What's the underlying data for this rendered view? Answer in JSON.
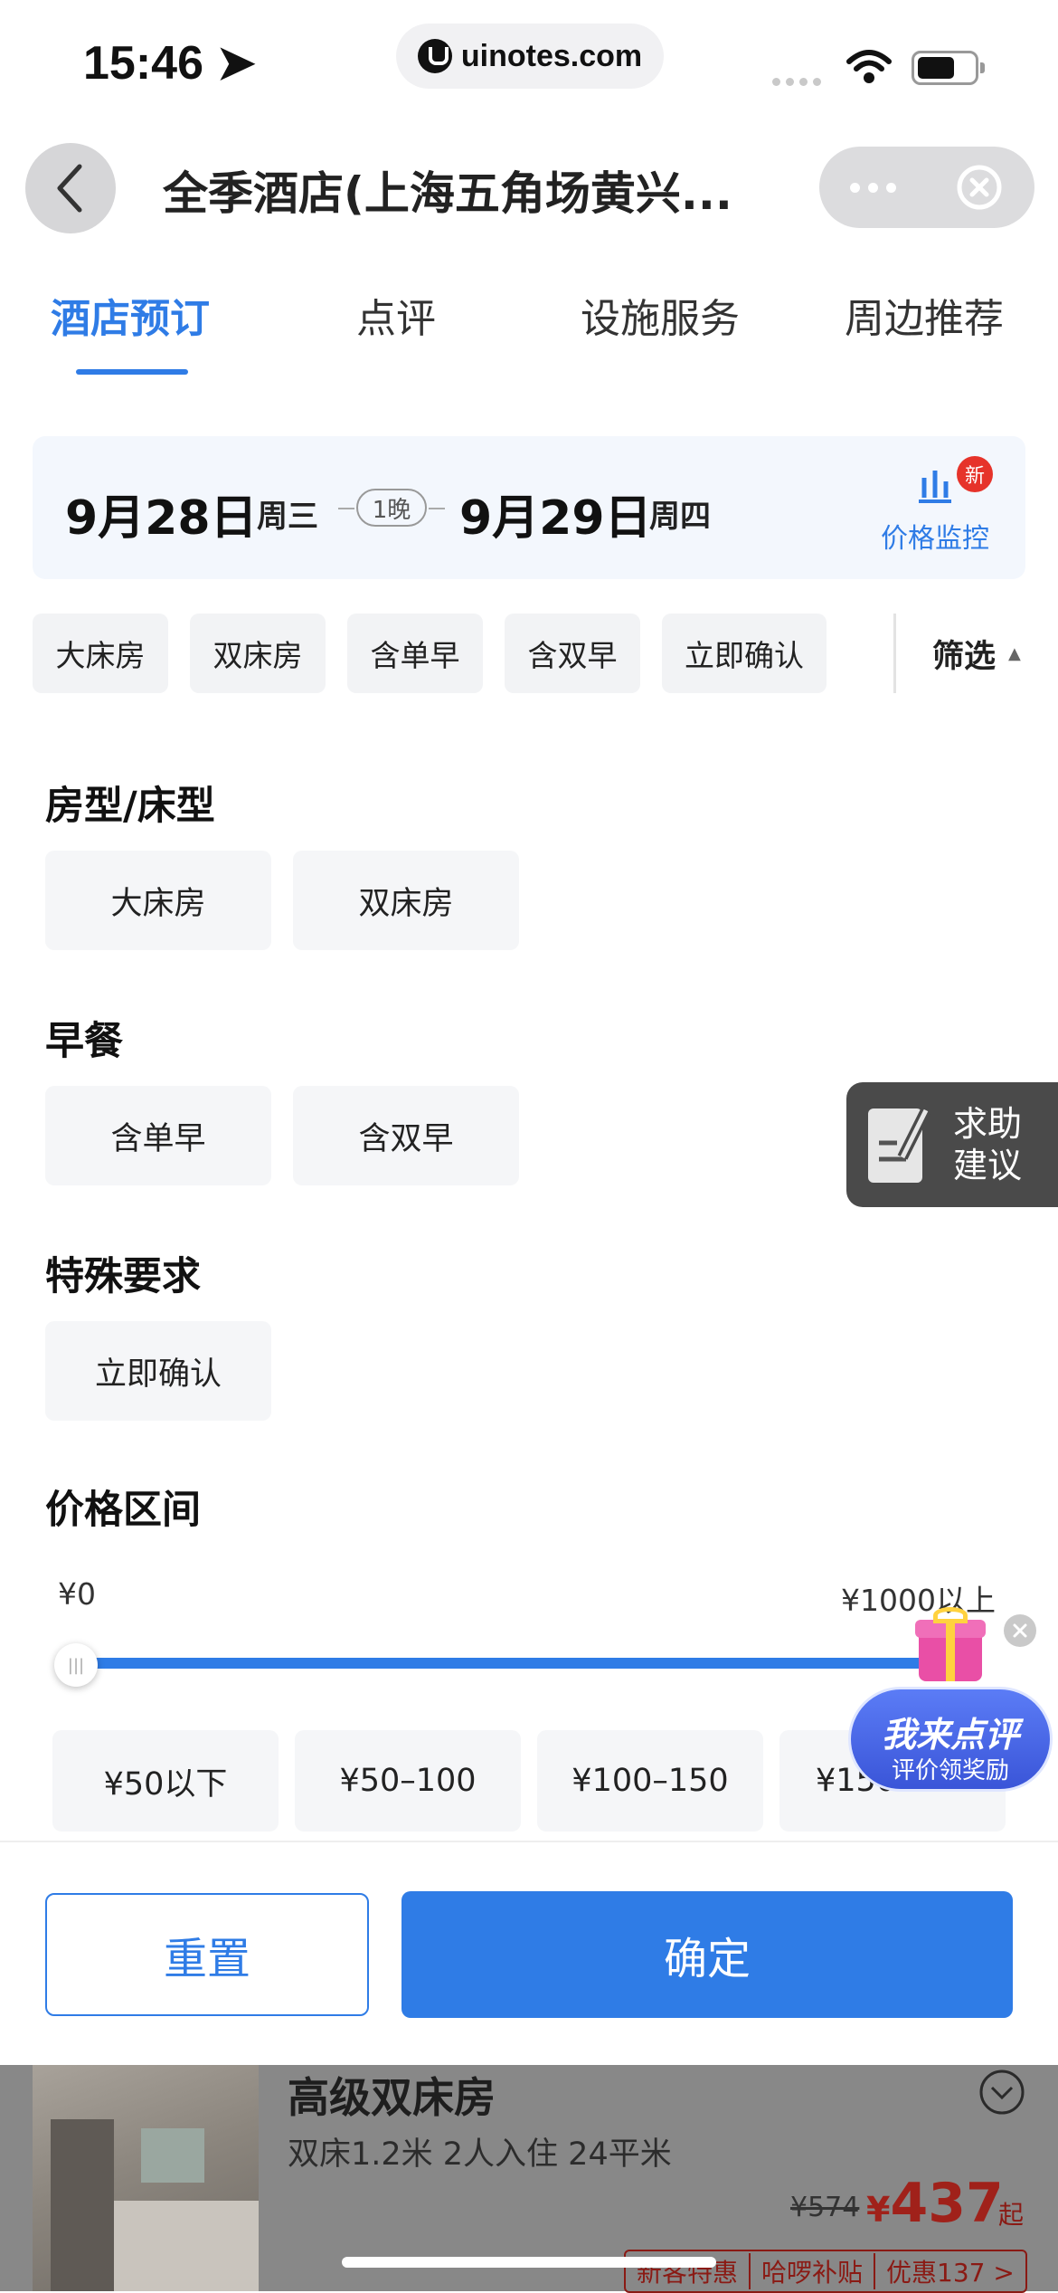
{
  "status_bar": {
    "time": "15:46",
    "url": "uinotes.com"
  },
  "nav": {
    "title": "全季酒店(上海五角场黄兴..."
  },
  "tabs": [
    {
      "label": "酒店预订",
      "active": true
    },
    {
      "label": "点评"
    },
    {
      "label": "设施服务"
    },
    {
      "label": "周边推荐"
    }
  ],
  "date_bar": {
    "checkin_date": "9月28日",
    "checkin_weekday": "周三",
    "nights": "1晚",
    "checkout_date": "9月29日",
    "checkout_weekday": "周四",
    "monitor_label": "价格监控",
    "new_badge": "新"
  },
  "quick_filters": [
    "大床房",
    "双床房",
    "含单早",
    "含双早",
    "立即确认"
  ],
  "filter_button": "筛选",
  "sections": {
    "room_type": {
      "title": "房型/床型",
      "options": [
        "大床房",
        "双床房"
      ]
    },
    "breakfast": {
      "title": "早餐",
      "options": [
        "含单早",
        "含双早"
      ]
    },
    "special": {
      "title": "特殊要求",
      "options": [
        "立即确认"
      ]
    },
    "price": {
      "title": "价格区间",
      "min_label": "¥0",
      "max_label": "¥1000以上",
      "range_selected": [
        0,
        1
      ],
      "options": [
        "¥50以下",
        "¥50–100",
        "¥100–150",
        "¥150–200"
      ]
    }
  },
  "help_float": {
    "line1": "求助",
    "line2": "建议"
  },
  "review_float": {
    "title": "我来点评",
    "subtitle": "评价领奖励"
  },
  "actions": {
    "reset": "重置",
    "confirm": "确定"
  },
  "room_card": {
    "title": "高级双床房",
    "meta": "双床1.2米 2人入住 24平米",
    "old_price": "¥574",
    "currency": "¥",
    "price": "437",
    "price_suffix": "起",
    "tags": [
      "新客特惠",
      "哈啰补贴",
      "优惠137 >"
    ]
  },
  "colors": {
    "accent": "#2f7ce6",
    "badge_red": "#e6332a"
  }
}
